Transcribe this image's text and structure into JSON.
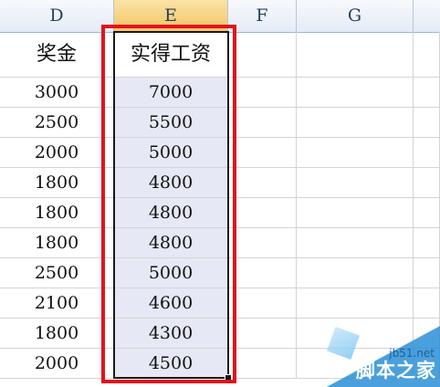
{
  "columns": [
    "D",
    "E",
    "F",
    "G"
  ],
  "selected_column": "E",
  "header_row": {
    "D": "奖金",
    "E": "实得工资"
  },
  "rows": [
    {
      "D": "3000",
      "E": "7000"
    },
    {
      "D": "2500",
      "E": "5500"
    },
    {
      "D": "2000",
      "E": "5000"
    },
    {
      "D": "1800",
      "E": "4800"
    },
    {
      "D": "1800",
      "E": "4800"
    },
    {
      "D": "1800",
      "E": "4800"
    },
    {
      "D": "2500",
      "E": "5000"
    },
    {
      "D": "2100",
      "E": "4600"
    },
    {
      "D": "1800",
      "E": "4300"
    },
    {
      "D": "2000",
      "E": "4500"
    }
  ],
  "watermark": {
    "site": "jb51.net",
    "brand": "脚本之家"
  },
  "colors": {
    "highlight_frame": "#e3111c",
    "selection_fill": "#e6e9f5",
    "selected_header": "#f4c35f"
  }
}
